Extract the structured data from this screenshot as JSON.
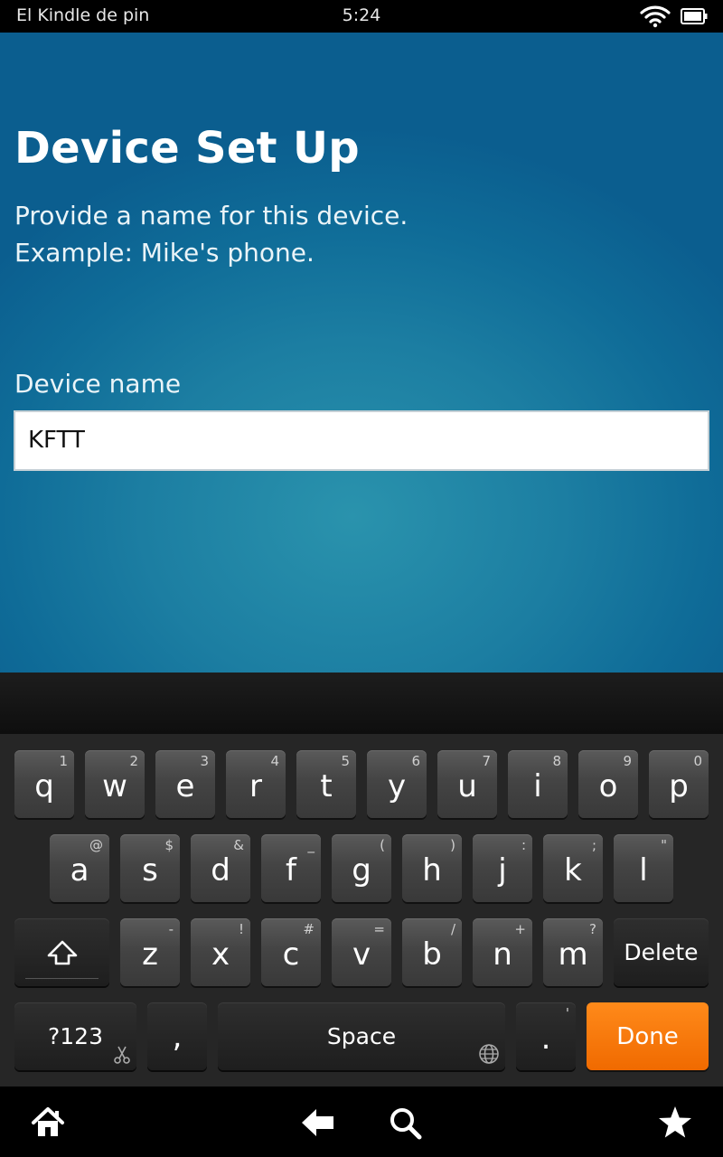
{
  "status_bar": {
    "carrier": "El Kindle de pin",
    "time": "5:24",
    "wifi_icon": "wifi-icon",
    "battery_icon": "battery-icon"
  },
  "page": {
    "title": "Device Set Up",
    "instruction_line1": "Provide a name for this device.",
    "instruction_line2": "Example: Mike's phone.",
    "field_label": "Device name",
    "device_name_value": "KFTT"
  },
  "keyboard": {
    "row1": [
      {
        "key": "q",
        "sub": "1"
      },
      {
        "key": "w",
        "sub": "2"
      },
      {
        "key": "e",
        "sub": "3"
      },
      {
        "key": "r",
        "sub": "4"
      },
      {
        "key": "t",
        "sub": "5"
      },
      {
        "key": "y",
        "sub": "6"
      },
      {
        "key": "u",
        "sub": "7"
      },
      {
        "key": "i",
        "sub": "8"
      },
      {
        "key": "o",
        "sub": "9"
      },
      {
        "key": "p",
        "sub": "0"
      }
    ],
    "row2": [
      {
        "key": "a",
        "sub": "@"
      },
      {
        "key": "s",
        "sub": "$"
      },
      {
        "key": "d",
        "sub": "&"
      },
      {
        "key": "f",
        "sub": "_"
      },
      {
        "key": "g",
        "sub": "("
      },
      {
        "key": "h",
        "sub": ")"
      },
      {
        "key": "j",
        "sub": ":"
      },
      {
        "key": "k",
        "sub": ";"
      },
      {
        "key": "l",
        "sub": "\""
      }
    ],
    "row3": [
      {
        "key": "z",
        "sub": "-"
      },
      {
        "key": "x",
        "sub": "!"
      },
      {
        "key": "c",
        "sub": "#"
      },
      {
        "key": "v",
        "sub": "="
      },
      {
        "key": "b",
        "sub": "/"
      },
      {
        "key": "n",
        "sub": "+"
      },
      {
        "key": "m",
        "sub": "?"
      }
    ],
    "shift_icon": "shift-icon",
    "delete_label": "Delete",
    "symbols_label": "?123",
    "comma_label": ",",
    "space_label": "Space",
    "period_label": ".",
    "period_sub": "'",
    "done_label": "Done",
    "done_color": "#f47a0a"
  },
  "nav_bar": {
    "home_icon": "home-icon",
    "back_icon": "back-icon",
    "search_icon": "search-icon",
    "favorites_icon": "star-icon"
  }
}
